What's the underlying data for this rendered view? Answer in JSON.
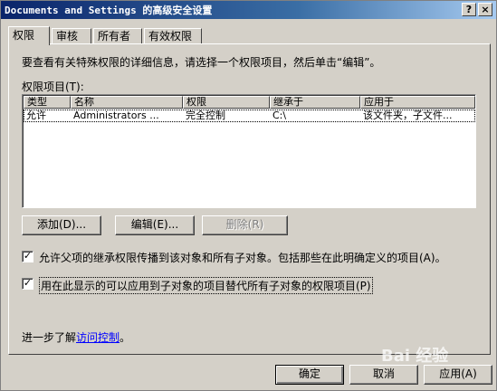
{
  "window": {
    "title": "Documents and Settings 的高级安全设置",
    "help_glyph": "?",
    "close_glyph": "×"
  },
  "tabs": [
    {
      "label": "权限",
      "active": true
    },
    {
      "label": "审核",
      "active": false
    },
    {
      "label": "所有者",
      "active": false
    },
    {
      "label": "有效权限",
      "active": false
    }
  ],
  "panel": {
    "intro": "要查看有关特殊权限的详细信息，请选择一个权限项目，然后单击“编辑”。",
    "entries_label": "权限项目(T):",
    "columns": [
      "类型",
      "名称",
      "权限",
      "继承于",
      "应用于"
    ],
    "rows": [
      [
        "允许",
        "Administrators ...",
        "完全控制",
        "C:\\",
        "该文件夹，子文件..."
      ]
    ],
    "buttons": {
      "add": "添加(D)...",
      "edit": "编辑(E)...",
      "remove": "删除(R)"
    },
    "inherit_checkbox": {
      "checked": true,
      "label": "允许父项的继承权限传播到该对象和所有子对象。包括那些在此明确定义的项目(A)。"
    },
    "replace_checkbox": {
      "checked": true,
      "label": "用在此显示的可以应用到子对象的项目替代所有子对象的权限项目(P)"
    },
    "learn_prefix": "进一步了解",
    "learn_link": "访问控制",
    "learn_suffix": "。"
  },
  "footer": {
    "ok": "确定",
    "cancel": "取消",
    "apply": "应用(A)"
  },
  "watermark": "Bai 经验",
  "check_glyph": "✓"
}
